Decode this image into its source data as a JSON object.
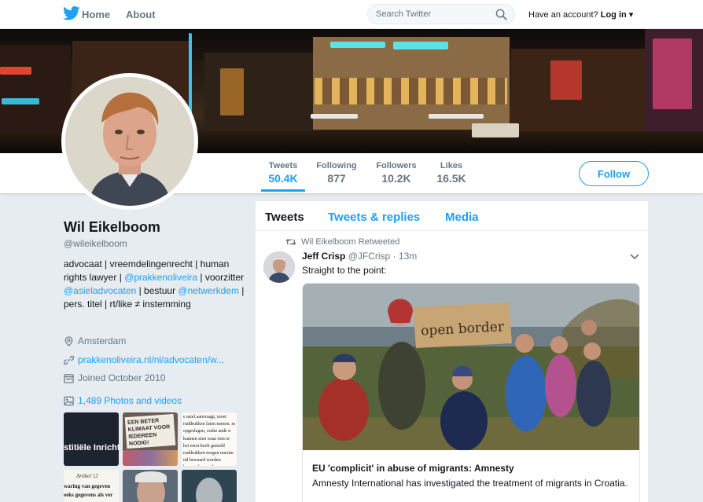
{
  "nav": {
    "home_label": "Home",
    "about_label": "About",
    "search_placeholder": "Search Twitter",
    "account_prompt": "Have an account?",
    "login_label": "Log in"
  },
  "profile": {
    "name": "Wil Eikelboom",
    "handle": "@wileikelboom",
    "bio": {
      "part1": "advocaat | vreemdelingenrecht | human rights lawyer | ",
      "link1": "@prakkenoliveira",
      "part2": " | voorzitter ",
      "link2": "@asieladvocaten",
      "part3": " | bestuur ",
      "link3": "@netwerkdem",
      "part4": " | pers. titel | rt/like ≠ instemming"
    },
    "location": "Amsterdam",
    "website": "prakkenoliveira.nl/nl/advocaten/w...",
    "joined": "Joined October 2010",
    "photos_label": "1,489 Photos and videos"
  },
  "stats": [
    {
      "label": "Tweets",
      "value": "50.4K"
    },
    {
      "label": "Following",
      "value": "877"
    },
    {
      "label": "Followers",
      "value": "10.2K"
    },
    {
      "label": "Likes",
      "value": "16.5K"
    }
  ],
  "follow_label": "Follow",
  "tabs": [
    {
      "label": "Tweets"
    },
    {
      "label": "Tweets & replies"
    },
    {
      "label": "Media"
    }
  ],
  "tweet": {
    "retweet_context": "Wil Eikelboom Retweeted",
    "author_name": "Jeff Crisp",
    "author_handle": "@JFCrisp",
    "separator": "·",
    "time": "13m",
    "text": "Straight to the point:",
    "card": {
      "sign_text": "open border",
      "title": "EU 'complicit' in abuse of migrants: Amnesty",
      "description": "Amnesty International has investigated the treatment of migrants in Croatia."
    }
  },
  "thumbnails": {
    "t1_text": "stitiële Inricht",
    "t2_sign": "EEN BETER KLIMAAT VOOR IEDEREEN NODIG!",
    "t3_text": "e asiel aanvraagt, moet ruddrukken laten nemen. m opgeslagen, zodat ande n kunnen zien waar iem or het eerst heeft gemeld ruddrukken mogen maxim iid bewaard worden bewaard e worden er vernietigd.",
    "t4_title": "Artikel 12",
    "t4_text": "waring van gegeven eeks gegevens als ver"
  }
}
